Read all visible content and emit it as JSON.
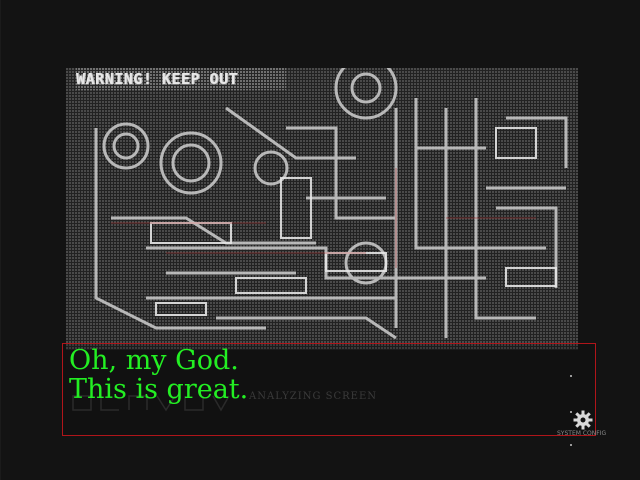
{
  "scene": {
    "sign_text": "WARNING! KEEP OUT"
  },
  "dialog": {
    "line1": "Oh, my God.",
    "line2": "This is great.",
    "subtext": "ANALYZING SCREEN"
  },
  "config_button": {
    "icon": "gear-icon",
    "label": "SYSTEM CONFIG"
  },
  "colors": {
    "dialog_text": "#23ef23",
    "dialog_border": "#b0151a",
    "background": "#131313"
  }
}
